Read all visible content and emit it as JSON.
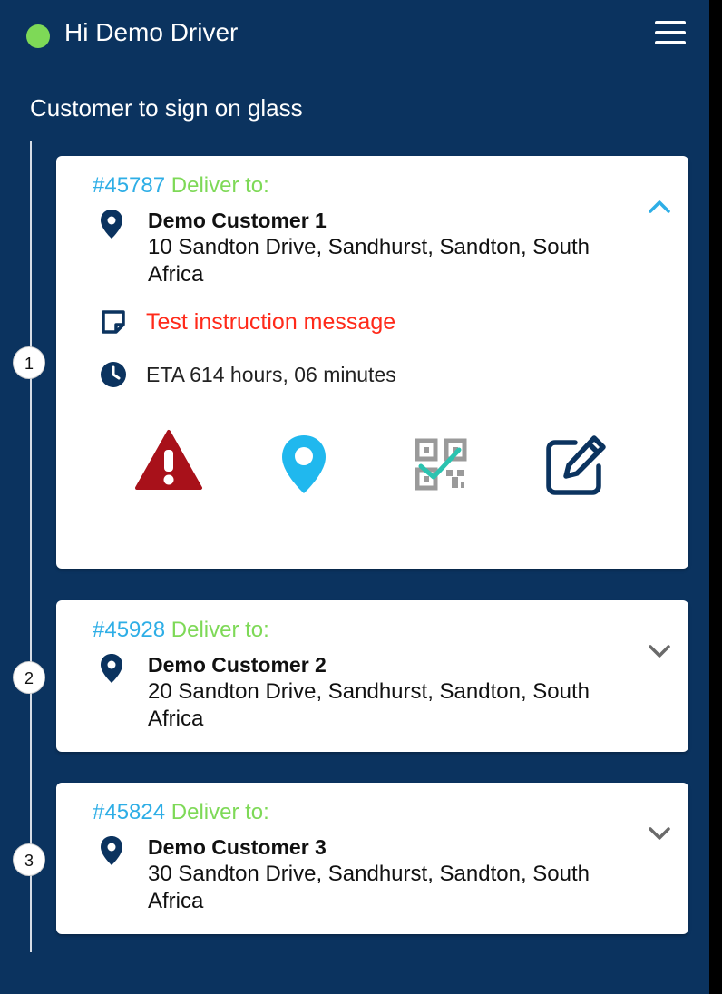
{
  "header": {
    "greeting": "Hi Demo Driver",
    "status_color": "#7ed957",
    "menu_icon": "hamburger-menu-icon"
  },
  "section_title": "Customer to sign on glass",
  "colors": {
    "background": "#0b335f",
    "order_id": "#2eaee6",
    "deliver_label": "#7ed957",
    "instruction": "#ff2a1a",
    "danger": "#a8111a",
    "location": "#20b8ee",
    "primary_icon": "#0b335f"
  },
  "deliveries": [
    {
      "step": "1",
      "order_id": "#45787",
      "deliver_label": "Deliver to:",
      "customer": "Demo Customer 1",
      "address": "10 Sandton Drive, Sandhurst, Sandton, South Africa",
      "instruction": "Test instruction message",
      "eta": "ETA 614 hours, 06 minutes",
      "expanded": true,
      "actions": [
        "warning-icon",
        "location-pin-icon",
        "qr-code-check-icon",
        "edit-icon"
      ]
    },
    {
      "step": "2",
      "order_id": "#45928",
      "deliver_label": "Deliver to:",
      "customer": "Demo Customer 2",
      "address": "20 Sandton Drive, Sandhurst, Sandton, South Africa",
      "expanded": false
    },
    {
      "step": "3",
      "order_id": "#45824",
      "deliver_label": "Deliver to:",
      "customer": "Demo Customer 3",
      "address": "30 Sandton Drive, Sandhurst, Sandton, South Africa",
      "expanded": false
    }
  ]
}
